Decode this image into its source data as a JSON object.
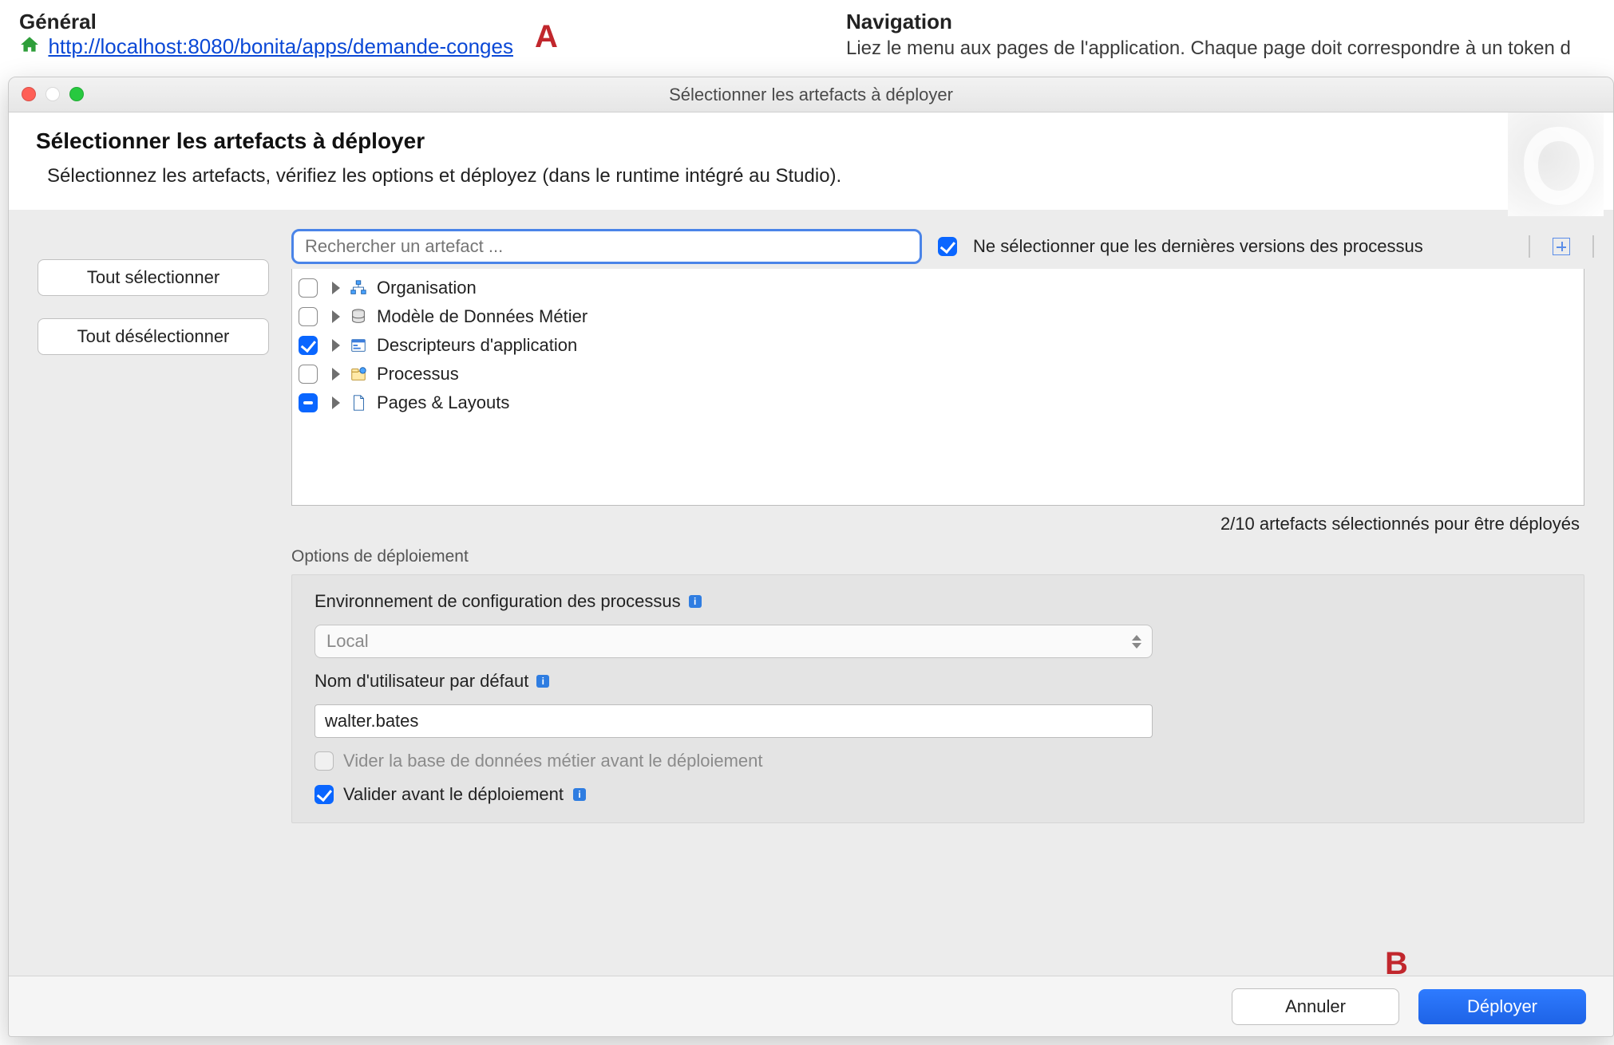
{
  "background": {
    "left_title": "Général",
    "left_url": "http://localhost:8080/bonita/apps/demande-conges",
    "right_title": "Navigation",
    "right_sub": "Liez le menu aux pages de l'application. Chaque page doit correspondre à un token d"
  },
  "callouts": {
    "a": "A",
    "b": "B"
  },
  "modal": {
    "title": "Sélectionner les artefacts à déployer",
    "heading": "Sélectionner les artefacts à déployer",
    "subtitle": "Sélectionnez les artefacts, vérifiez les options et déployez (dans le runtime intégré au Studio).",
    "search_placeholder": "Rechercher un artefact ...",
    "latest_only_label": "Ne sélectionner que les dernières versions des processus",
    "latest_only_checked": true,
    "select_all": "Tout sélectionner",
    "deselect_all": "Tout désélectionner",
    "tree": [
      {
        "id": "organisation",
        "label": "Organisation",
        "state": "off",
        "icon": "org-icon"
      },
      {
        "id": "bdm",
        "label": "Modèle de Données Métier",
        "state": "off",
        "icon": "db-icon"
      },
      {
        "id": "app-desc",
        "label": "Descripteurs d'application",
        "state": "on",
        "icon": "appdesc-icon"
      },
      {
        "id": "process",
        "label": "Processus",
        "state": "off",
        "icon": "process-icon"
      },
      {
        "id": "pages",
        "label": "Pages & Layouts",
        "state": "mixed",
        "icon": "page-icon"
      }
    ],
    "status": "2/10 artefacts sélectionnés pour être déployés",
    "options": {
      "group_title": "Options de déploiement",
      "env_label": "Environnement de configuration des processus",
      "env_value": "Local",
      "user_label": "Nom d'utilisateur par défaut",
      "user_value": "walter.bates",
      "drop_bdm_label": "Vider la base de données métier avant le déploiement",
      "drop_bdm_checked": false,
      "drop_bdm_disabled": true,
      "validate_label": "Valider avant le déploiement",
      "validate_checked": true
    },
    "footer": {
      "cancel": "Annuler",
      "deploy": "Déployer"
    }
  },
  "colors": {
    "accent": "#0a66ff",
    "link": "#0a48d6",
    "callout": "#c1272d"
  }
}
